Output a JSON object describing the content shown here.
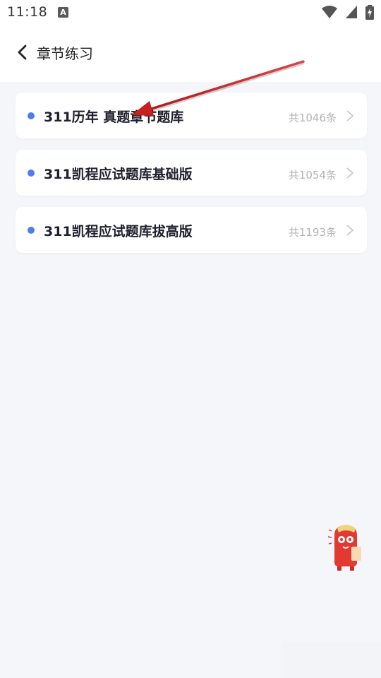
{
  "status": {
    "time": "11:18",
    "notification_icon": "a-icon",
    "icons": [
      "wifi-icon",
      "signal-icon",
      "battery-charging-icon"
    ]
  },
  "header": {
    "title": "章节练习"
  },
  "items": [
    {
      "title": "311历年 真题章节题库",
      "count": "共1046条"
    },
    {
      "title": "311凯程应试题库基础版",
      "count": "共1054条"
    },
    {
      "title": "311凯程应试题库拔高版",
      "count": "共1193条"
    }
  ],
  "colors": {
    "dot": "#4f7df0",
    "arrow": "#d22b2b",
    "background": "#f5f6fa"
  }
}
